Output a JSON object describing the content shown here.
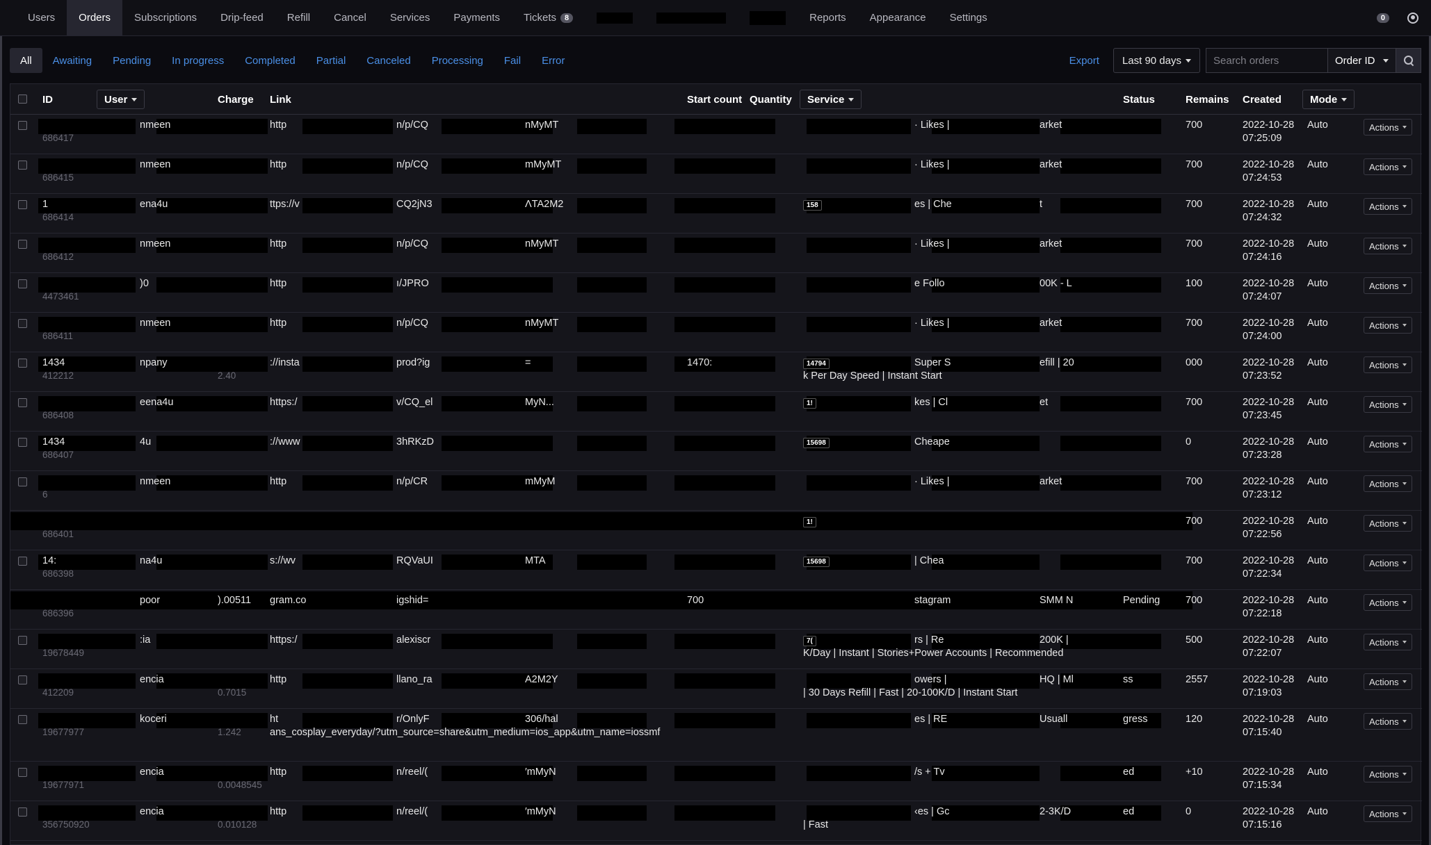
{
  "nav": {
    "items": [
      "Users",
      "Orders",
      "Subscriptions",
      "Drip-feed",
      "Refill",
      "Cancel",
      "Services",
      "Payments",
      "Tickets"
    ],
    "active": "Orders",
    "tickets_count": "8",
    "items_right": [
      "Reports",
      "Appearance",
      "Settings"
    ],
    "notif_count": "0"
  },
  "filters": {
    "tabs": [
      "All",
      "Awaiting",
      "Pending",
      "In progress",
      "Completed",
      "Partial",
      "Canceled",
      "Processing",
      "Fail",
      "Error"
    ],
    "active": "All",
    "export_label": "Export",
    "date_range": "Last 90 days",
    "search_placeholder": "Search orders",
    "search_field": "Order ID"
  },
  "table": {
    "headers": {
      "id": "ID",
      "user": "User",
      "charge": "Charge",
      "link": "Link",
      "start_count": "Start count",
      "quantity": "Quantity",
      "service": "Service",
      "status": "Status",
      "remains": "Remains",
      "created": "Created",
      "mode": "Mode"
    },
    "actions_label": "Actions",
    "rows": [
      {
        "id_top": "",
        "sub_id": "686417",
        "user": "nmeen",
        "charge_sub": "",
        "link_a": "http",
        "link_b": "n/p/CQ",
        "link_c": "nMyMT",
        "start": "",
        "qty": "",
        "svc_id": "",
        "svc_a": "· Likes |",
        "svc_b": "arket",
        "svc_line2": "",
        "status": "",
        "remains": "700",
        "date": "2022-10-28",
        "time": "07:25:09",
        "mode": "Auto"
      },
      {
        "id_top": "",
        "sub_id": "686415",
        "user": "nmeen",
        "charge_sub": "",
        "link_a": "http",
        "link_b": "n/p/CQ",
        "link_c": "mMyMT",
        "start": "",
        "qty": "",
        "svc_id": "",
        "svc_a": "· Likes |",
        "svc_b": "arket",
        "svc_line2": "",
        "status": "",
        "remains": "700",
        "date": "2022-10-28",
        "time": "07:24:53",
        "mode": "Auto"
      },
      {
        "id_top": "1",
        "sub_id": "686414",
        "user": "ena4u",
        "charge_sub": "",
        "link_a": "ttps://v",
        "link_b": "CQ2jN3",
        "link_c": "ΛTA2M2",
        "start": "",
        "qty": "",
        "svc_id": "158",
        "svc_a": "es | Che",
        "svc_b": "t",
        "svc_line2": "",
        "status": "",
        "remains": "700",
        "date": "2022-10-28",
        "time": "07:24:32",
        "mode": "Auto"
      },
      {
        "id_top": "",
        "sub_id": "686412",
        "user": "nmeen",
        "charge_sub": "",
        "link_a": "http",
        "link_b": "n/p/CQ",
        "link_c": "nMyMT",
        "start": "",
        "qty": "",
        "svc_id": "",
        "svc_a": "· Likes |",
        "svc_b": "arket",
        "svc_line2": "",
        "status": "",
        "remains": "700",
        "date": "2022-10-28",
        "time": "07:24:16",
        "mode": "Auto"
      },
      {
        "id_top": "",
        "sub_id": "4473461",
        "user": ")0",
        "charge_sub": "",
        "link_a": "http",
        "link_b": "ı/JPRO",
        "link_c": "",
        "start": "",
        "qty": "",
        "svc_id": "",
        "svc_a": "e Follo",
        "svc_b": "00K - L",
        "svc_line2": "",
        "status": "",
        "remains": "100",
        "date": "2022-10-28",
        "time": "07:24:07",
        "mode": "Auto"
      },
      {
        "id_top": "",
        "sub_id": "686411",
        "user": "nmeen",
        "charge_sub": "",
        "link_a": "http",
        "link_b": "n/p/CQ",
        "link_c": "nMyMT",
        "start": "",
        "qty": "",
        "svc_id": "",
        "svc_a": "· Likes |",
        "svc_b": "arket",
        "svc_line2": "",
        "status": "",
        "remains": "700",
        "date": "2022-10-28",
        "time": "07:24:00",
        "mode": "Auto"
      },
      {
        "id_top": "1434",
        "sub_id": "412212",
        "user": "npany",
        "charge_sub": "2.40",
        "link_a": "://insta",
        "link_b": "prod?ig",
        "link_c": "=",
        "start": "1470:",
        "qty": "",
        "svc_id": "14794",
        "svc_a": "Super S",
        "svc_b": "efill | 20",
        "svc_line2": "k Per Day Speed | Instant Start",
        "status": "",
        "remains": "000",
        "date": "2022-10-28",
        "time": "07:23:52",
        "mode": "Auto"
      },
      {
        "id_top": "",
        "sub_id": "686408",
        "user": "eena4u",
        "charge_sub": "",
        "link_a": "https:/",
        "link_b": "v/CQ_el",
        "link_c": "MyN...",
        "start": "",
        "qty": "",
        "svc_id": "1!",
        "svc_a": "kes | Cl",
        "svc_b": "et",
        "svc_line2": "",
        "status": "",
        "remains": "700",
        "date": "2022-10-28",
        "time": "07:23:45",
        "mode": "Auto"
      },
      {
        "id_top": "1434",
        "sub_id": "686407",
        "user": "4u",
        "charge_sub": "",
        "link_a": "://www",
        "link_b": "3hRKzD",
        "link_c": "",
        "start": "",
        "qty": "",
        "svc_id": "15698",
        "svc_a": "Cheape",
        "svc_b": "",
        "svc_line2": "",
        "status": "",
        "remains": "0",
        "date": "2022-10-28",
        "time": "07:23:28",
        "mode": "Auto"
      },
      {
        "id_top": "",
        "sub_id": "6",
        "user": "nmeen",
        "charge_sub": "",
        "link_a": "http",
        "link_b": "n/p/CR",
        "link_c": "mMyM",
        "start": "",
        "qty": "",
        "svc_id": "",
        "svc_a": "· Likes |",
        "svc_b": "arket",
        "svc_line2": "",
        "status": "",
        "remains": "700",
        "date": "2022-10-28",
        "time": "07:23:12",
        "mode": "Auto"
      },
      {
        "id_top": "",
        "sub_id": "686401",
        "user": "",
        "charge_sub": "",
        "link_a": "",
        "link_b": "",
        "link_c": "",
        "start": "",
        "qty": "",
        "svc_id": "1!",
        "svc_a": "",
        "svc_b": "",
        "svc_line2": "",
        "status": "",
        "remains": "700",
        "date": "2022-10-28",
        "time": "07:22:56",
        "mode": "Auto"
      },
      {
        "id_top": "14:",
        "sub_id": "686398",
        "user": "na4u",
        "charge_sub": "",
        "link_a": "s://wv",
        "link_b": "RQVaUI",
        "link_c": "MTA",
        "start": "",
        "qty": "",
        "svc_id": "15698",
        "svc_a": "| Chea",
        "svc_b": "",
        "svc_line2": "",
        "status": "",
        "remains": "700",
        "date": "2022-10-28",
        "time": "07:22:34",
        "mode": "Auto"
      },
      {
        "id_top": "",
        "sub_id": "686396",
        "user": "poor",
        "charge_top": ").00511",
        "charge_sub": "",
        "link_a": "gram.co",
        "link_b": "igshid=",
        "link_c": "",
        "start": "700",
        "qty": "",
        "svc_id": "",
        "svc_a": "stagram",
        "svc_b": "SMM N",
        "svc_line2": "",
        "status": "Pending",
        "remains": "700",
        "date": "2022-10-28",
        "time": "07:22:18",
        "mode": "Auto"
      },
      {
        "id_top": "",
        "sub_id": "19678449",
        "user": ":ia",
        "charge_sub": "",
        "link_a": "https:/",
        "link_b": "alexiscr",
        "link_c": "",
        "start": "",
        "qty": "",
        "svc_id": "7(",
        "svc_a": "rs | Re",
        "svc_b": "200K |",
        "svc_line2": "K/Day | Instant | Stories+Power Accounts | Recommended",
        "status": "",
        "remains": "500",
        "date": "2022-10-28",
        "time": "07:22:07",
        "mode": "Auto"
      },
      {
        "id_top": "",
        "sub_id": "412209",
        "user": "encia",
        "charge_sub": "0.7015",
        "link_a": "http",
        "link_b": "llano_ra",
        "link_c": "A2M2Y",
        "start": "",
        "qty": "",
        "svc_id": "",
        "svc_a": "owers |",
        "svc_b": "HQ | Ml",
        "svc_line2": "| 30 Days Refill | Fast | 20-100K/D | Instant Start",
        "status": "ss",
        "remains": "2557",
        "date": "2022-10-28",
        "time": "07:19:03",
        "mode": "Auto"
      },
      {
        "id_top": "",
        "sub_id": "19677977",
        "user": "koceri",
        "charge_sub": "1.242",
        "link_a": "ht",
        "link_b": "r/OnlyF",
        "link_c": "306/hal",
        "link_line2": "ans_cosplay_everyday/?utm_source=share&utm_medium=ios_app&utm_name=iossmf",
        "start": "",
        "qty": "",
        "svc_id": "",
        "svc_a": "es | RE",
        "svc_b": "Usuall",
        "svc_line2": "",
        "status": "gress",
        "remains": "120",
        "date": "2022-10-28",
        "time": "07:15:40",
        "mode": "Auto"
      },
      {
        "id_top": "",
        "sub_id": "19677971",
        "user": "encia",
        "charge_sub": "0.0048545",
        "link_a": "http",
        "link_b": "n/reel/(",
        "link_c": "′mMyN",
        "start": "",
        "qty": "",
        "svc_id": "",
        "svc_a": "/s + Tv",
        "svc_b": "",
        "svc_line2": "",
        "status": "ed",
        "remains": "+10",
        "date": "2022-10-28",
        "time": "07:15:34",
        "mode": "Auto"
      },
      {
        "id_top": "",
        "sub_id": "356750920",
        "user": "encia",
        "charge_sub": "0.010128",
        "link_a": "http",
        "link_b": "n/reel/(",
        "link_c": "′mMyN",
        "start": "",
        "qty": "",
        "svc_id": "",
        "svc_a": "‹es | Gc",
        "svc_b": "2-3K/D",
        "svc_line2": "| Fast",
        "status": "ed",
        "remains": "0",
        "date": "2022-10-28",
        "time": "07:15:16",
        "mode": "Auto"
      }
    ]
  }
}
